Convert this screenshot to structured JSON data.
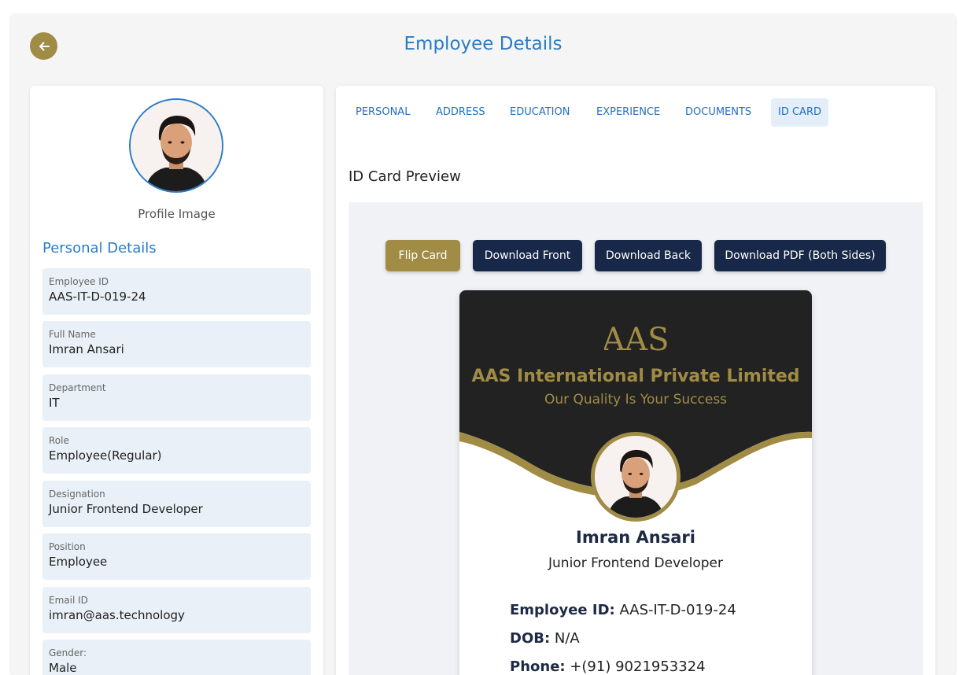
{
  "page": {
    "title": "Employee Details"
  },
  "profile": {
    "image_label": "Profile Image",
    "section_title": "Personal Details",
    "fields": [
      {
        "label": "Employee ID",
        "value": "AAS-IT-D-019-24"
      },
      {
        "label": "Full Name",
        "value": "Imran Ansari"
      },
      {
        "label": "Department",
        "value": "IT"
      },
      {
        "label": "Role",
        "value": "Employee(Regular)"
      },
      {
        "label": "Designation",
        "value": "Junior Frontend Developer"
      },
      {
        "label": "Position",
        "value": "Employee"
      },
      {
        "label": "Email ID",
        "value": "imran@aas.technology"
      },
      {
        "label": "Gender:",
        "value": "Male"
      }
    ]
  },
  "tabs": [
    {
      "label": "PERSONAL",
      "active": false
    },
    {
      "label": "ADDRESS",
      "active": false
    },
    {
      "label": "EDUCATION",
      "active": false
    },
    {
      "label": "EXPERIENCE",
      "active": false
    },
    {
      "label": "DOCUMENTS",
      "active": false
    },
    {
      "label": "ID CARD",
      "active": true
    }
  ],
  "preview": {
    "heading": "ID Card Preview",
    "buttons": {
      "flip": "Flip Card",
      "download_front": "Download Front",
      "download_back": "Download Back",
      "download_pdf": "Download PDF (Both Sides)"
    }
  },
  "id_card": {
    "logo_text": "AAS",
    "company": "AAS International Private Limited",
    "tagline": "Our Quality Is Your Success",
    "name": "Imran Ansari",
    "designation": "Junior Frontend Developer",
    "employee_id_label": "Employee ID:",
    "employee_id": "AAS-IT-D-019-24",
    "dob_label": "DOB:",
    "dob": "N/A",
    "phone_label": "Phone:",
    "phone": "+(91) 9021953324"
  },
  "colors": {
    "accent_blue": "#2a7cc7",
    "gold": "#a08c45",
    "navy": "#172848",
    "card_dark": "#222222"
  }
}
